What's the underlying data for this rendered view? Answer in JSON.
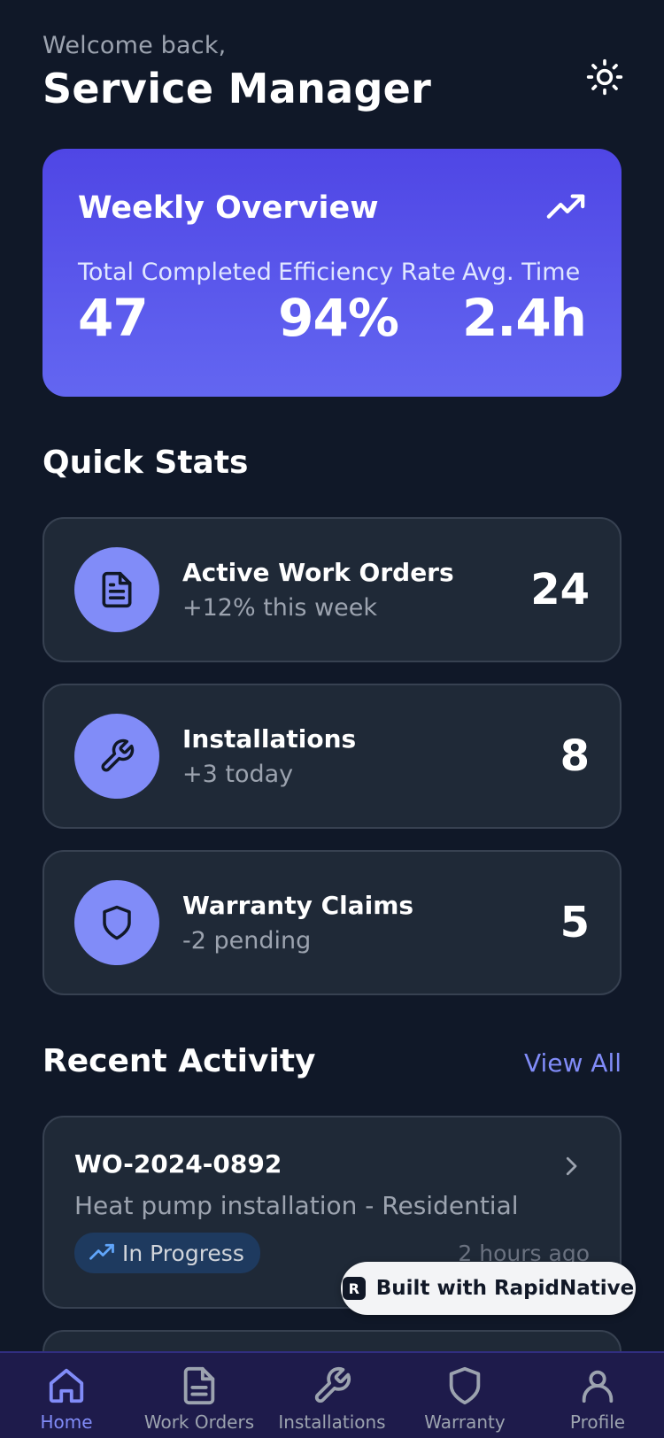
{
  "header": {
    "welcome": "Welcome back,",
    "title": "Service Manager",
    "theme_icon": "sun-icon"
  },
  "overview": {
    "title": "Weekly Overview",
    "trend_icon": "trending-up-icon",
    "stats": [
      {
        "label": "Total Completed",
        "value": "47"
      },
      {
        "label": "Efficiency Rate",
        "value": "94%"
      },
      {
        "label": "Avg. Time",
        "value": "2.4h"
      }
    ]
  },
  "quick_stats": {
    "title": "Quick Stats",
    "items": [
      {
        "title": "Active Work Orders",
        "sub": "+12% this week",
        "value": "24",
        "icon": "document-icon"
      },
      {
        "title": "Installations",
        "sub": "+3 today",
        "value": "8",
        "icon": "wrench-icon"
      },
      {
        "title": "Warranty Claims",
        "sub": "-2 pending",
        "value": "5",
        "icon": "shield-icon"
      }
    ]
  },
  "recent": {
    "title": "Recent Activity",
    "view_all": "View All",
    "items": [
      {
        "id": "WO-2024-0892",
        "desc": "Heat pump installation - Residential",
        "status": "In Progress",
        "time": "2 hours ago"
      }
    ]
  },
  "badge": {
    "label": "Built with RapidNative"
  },
  "tabs": [
    {
      "label": "Home",
      "icon": "home-icon",
      "active": true
    },
    {
      "label": "Work Orders",
      "icon": "document-icon"
    },
    {
      "label": "Installations",
      "icon": "wrench-icon"
    },
    {
      "label": "Warranty",
      "icon": "shield-icon"
    },
    {
      "label": "Profile",
      "icon": "user-icon"
    }
  ],
  "colors": {
    "background": "#101828",
    "card": "#1f2937",
    "accent": "#818cf8",
    "overview_gradient_top": "#4f46e5",
    "overview_gradient_bottom": "#6366f1",
    "tabbar": "#1e1b4b"
  }
}
